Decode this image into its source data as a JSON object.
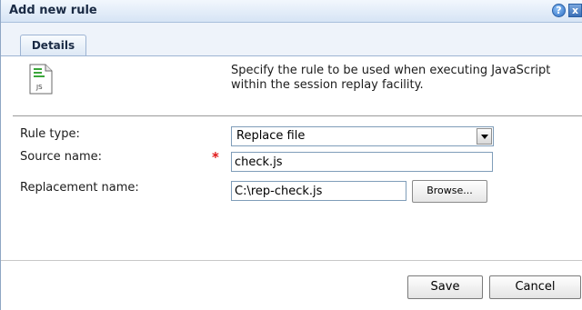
{
  "dialog": {
    "title": "Add new rule",
    "help_symbol": "?",
    "close_symbol": "x"
  },
  "tabs": [
    {
      "label": "Details"
    }
  ],
  "description": "Specify the rule to be used when executing JavaScript within the session replay facility.",
  "file_icon_text": "JS",
  "form": {
    "rule_type": {
      "label": "Rule type:",
      "value": "Replace file"
    },
    "source_name": {
      "label": "Source name:",
      "value": "check.js",
      "required_mark": "*"
    },
    "replacement_name": {
      "label": "Replacement name:",
      "value": "C:\\rep-check.js",
      "browse_label": "Browse..."
    }
  },
  "buttons": {
    "save": "Save",
    "cancel": "Cancel"
  },
  "colors": {
    "titlebar": "#d6e4f5",
    "required": "#e01818",
    "border_accent": "#7f9db9"
  }
}
